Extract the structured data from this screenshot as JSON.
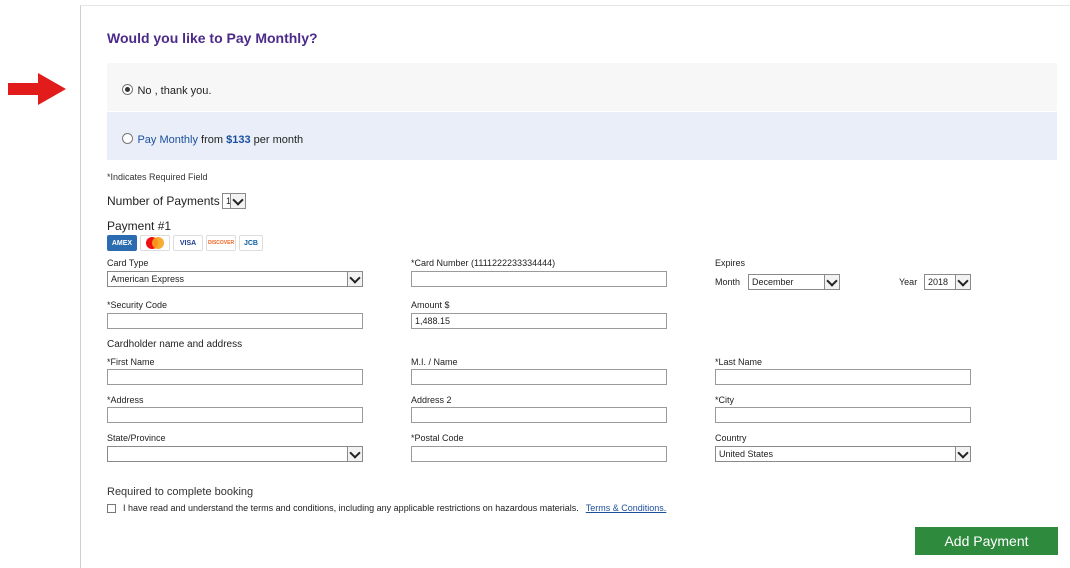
{
  "header": {
    "title": "Would you like to Pay Monthly?"
  },
  "options": {
    "no": {
      "label": "No , thank you."
    },
    "monthly": {
      "label_link": "Pay Monthly",
      "label_from": " from ",
      "amount": "$133",
      "label_per": " per month"
    }
  },
  "form": {
    "required_note": "*Indicates Required Field",
    "num_payments": {
      "label": "Number of Payments",
      "value": "1"
    },
    "payment_title": "Payment #1",
    "card_logos": [
      {
        "name": "amex-icon",
        "text": "AMEX"
      },
      {
        "name": "mastercard-icon",
        "text": ""
      },
      {
        "name": "visa-icon",
        "text": "VISA"
      },
      {
        "name": "discover-icon",
        "text": "DISCOVER"
      },
      {
        "name": "jcb-icon",
        "text": "JCB"
      }
    ],
    "card_type": {
      "label": "Card Type",
      "value": "American Express"
    },
    "card_number": {
      "label": "*Card Number (1111222233334444)",
      "value": ""
    },
    "expires": {
      "label": "Expires",
      "month_label": "Month",
      "month_value": "December",
      "year_label": "Year",
      "year_value": "2018"
    },
    "security_code": {
      "label": "*Security Code",
      "value": ""
    },
    "amount": {
      "label": "Amount $",
      "value": "1,488.15"
    },
    "holder_title": "Cardholder name and address",
    "first_name": {
      "label": "*First Name",
      "value": ""
    },
    "mi_name": {
      "label": "M.I. / Name",
      "value": ""
    },
    "last_name": {
      "label": "*Last Name",
      "value": ""
    },
    "address": {
      "label": "*Address",
      "value": ""
    },
    "address2": {
      "label": "Address 2",
      "value": ""
    },
    "city": {
      "label": "*City",
      "value": ""
    },
    "state": {
      "label": "State/Province",
      "value": ""
    },
    "postal": {
      "label": "*Postal Code",
      "value": ""
    },
    "country": {
      "label": "Country",
      "value": "United States"
    }
  },
  "booking": {
    "title": "Required to complete booking",
    "terms_text": "I have read and understand the terms and conditions, including any applicable restrictions on hazardous materials.",
    "terms_link": "Terms & Conditions."
  },
  "actions": {
    "add_payment": "Add Payment"
  },
  "colors": {
    "title": "#4b2a8a",
    "link": "#1b4f9c",
    "button": "#2e8b3d",
    "arrow": "#e21b1b"
  }
}
